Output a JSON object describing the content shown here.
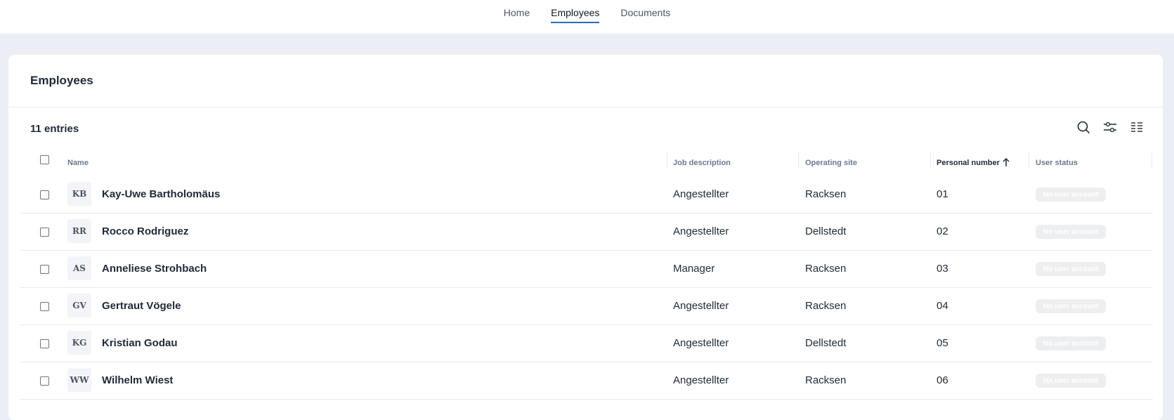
{
  "nav": {
    "items": [
      {
        "label": "Home"
      },
      {
        "label": "Employees"
      },
      {
        "label": "Documents"
      }
    ],
    "active": "Employees"
  },
  "page": {
    "title": "Employees",
    "entries": "11 entries"
  },
  "toolbar": {
    "icons": [
      "search-icon",
      "filter-sliders-icon",
      "columns-icon"
    ]
  },
  "table": {
    "columns": {
      "name": "Name",
      "job": "Job description",
      "site": "Operating site",
      "personal": "Personal number",
      "status": "User status"
    },
    "rows": [
      {
        "initials": "KB",
        "name": "Kay-Uwe Bartholomäus",
        "job": "Angestellter",
        "site": "Racksen",
        "number": "01",
        "status": "No user account"
      },
      {
        "initials": "RR",
        "name": "Rocco Rodriguez",
        "job": "Angestellter",
        "site": "Dellstedt",
        "number": "02",
        "status": "No user account"
      },
      {
        "initials": "AS",
        "name": "Anneliese Strohbach",
        "job": "Manager",
        "site": "Racksen",
        "number": "03",
        "status": "No user account"
      },
      {
        "initials": "GV",
        "name": "Gertraut Vögele",
        "job": "Angestellter",
        "site": "Racksen",
        "number": "04",
        "status": "No user account"
      },
      {
        "initials": "KG",
        "name": "Kristian Godau",
        "job": "Angestellter",
        "site": "Dellstedt",
        "number": "05",
        "status": "No user account"
      },
      {
        "initials": "WW",
        "name": "Wilhelm Wiest",
        "job": "Angestellter",
        "site": "Racksen",
        "number": "06",
        "status": "No user account"
      }
    ]
  },
  "colors": {
    "accent": "#2a6cc1",
    "background": "#eceef5"
  }
}
